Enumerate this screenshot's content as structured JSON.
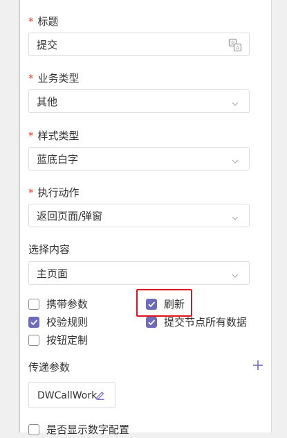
{
  "form": {
    "title_field": {
      "label": "标题",
      "required": true,
      "value": "提交",
      "icon": "translate-icon"
    },
    "business_type": {
      "label": "业务类型",
      "required": true,
      "value": "其他"
    },
    "style_type": {
      "label": "样式类型",
      "required": true,
      "value": "蓝底白字"
    },
    "action": {
      "label": "执行动作",
      "required": true,
      "value": "返回页面/弹窗"
    },
    "select_content": {
      "label": "选择内容",
      "required": false,
      "value": "主页面"
    },
    "required_mark": "*"
  },
  "options": [
    {
      "label": "携带参数",
      "checked": false
    },
    {
      "label": "刷新",
      "checked": true
    },
    {
      "label": "校验规则",
      "checked": true
    },
    {
      "label": "提交节点所有数据",
      "checked": true
    },
    {
      "label": "按钮定制",
      "checked": false
    }
  ],
  "params": {
    "label": "传递参数",
    "items": [
      "DWCallWork"
    ]
  },
  "display_option": {
    "label": "是否显示数字配置",
    "checked": false
  },
  "colors": {
    "accent": "#6e6cb8",
    "required": "#e0463a",
    "highlight": "#e0141e"
  }
}
